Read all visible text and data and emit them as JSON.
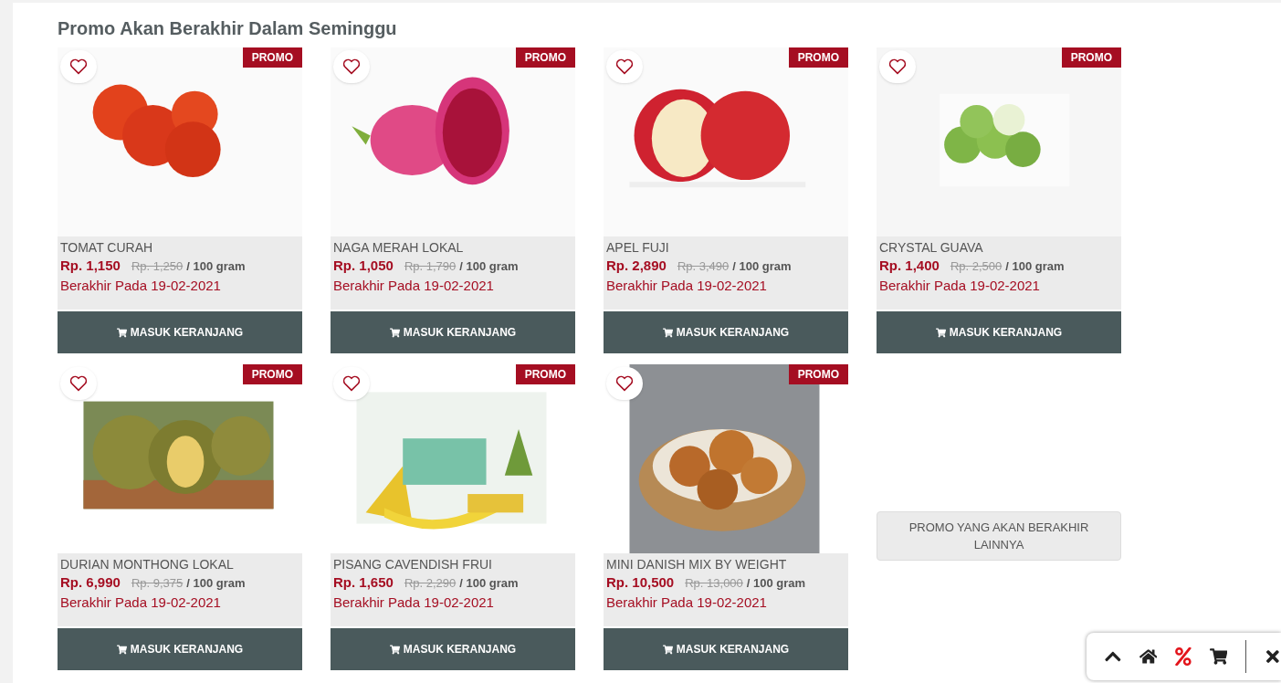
{
  "section_title": "Promo Akan Berakhir Dalam Seminggu",
  "products": [
    {
      "badge": "PROMO",
      "name": "TOMAT CURAH",
      "price": "Rp. 1,150",
      "old_price": "Rp. 1,250",
      "unit": "/ 100 gram",
      "ends": "Berakhir Pada 19-02-2021",
      "button": "MASUK KERANJANG"
    },
    {
      "badge": "PROMO",
      "name": "NAGA MERAH LOKAL",
      "price": "Rp. 1,050",
      "old_price": "Rp. 1,790",
      "unit": "/ 100 gram",
      "ends": "Berakhir Pada 19-02-2021",
      "button": "MASUK KERANJANG"
    },
    {
      "badge": "PROMO",
      "name": "APEL FUJI",
      "price": "Rp. 2,890",
      "old_price": "Rp. 3,490",
      "unit": "/ 100 gram",
      "ends": "Berakhir Pada 19-02-2021",
      "button": "MASUK KERANJANG"
    },
    {
      "badge": "PROMO",
      "name": "CRYSTAL GUAVA",
      "price": "Rp. 1,400",
      "old_price": "Rp. 2,500",
      "unit": "/ 100 gram",
      "ends": "Berakhir Pada 19-02-2021",
      "button": "MASUK KERANJANG"
    },
    {
      "badge": "PROMO",
      "name": "DURIAN MONTHONG LOKAL",
      "price": "Rp. 6,990",
      "old_price": "Rp. 9,375",
      "unit": "/ 100 gram",
      "ends": "Berakhir Pada 19-02-2021",
      "button": "MASUK KERANJANG"
    },
    {
      "badge": "PROMO",
      "name": "PISANG CAVENDISH FRUI",
      "price": "Rp. 1,650",
      "old_price": "Rp. 2,290",
      "unit": "/ 100 gram",
      "ends": "Berakhir Pada 19-02-2021",
      "button": "MASUK KERANJANG"
    },
    {
      "badge": "PROMO",
      "name": "MINI DANISH MIX BY WEIGHT",
      "price": "Rp. 10,500",
      "old_price": "Rp. 13,000",
      "unit": "/ 100 gram",
      "ends": "Berakhir Pada 19-02-2021",
      "button": "MASUK KERANJANG"
    }
  ],
  "more_button": "PROMO YANG AKAN BERAKHIR LAINNYA"
}
